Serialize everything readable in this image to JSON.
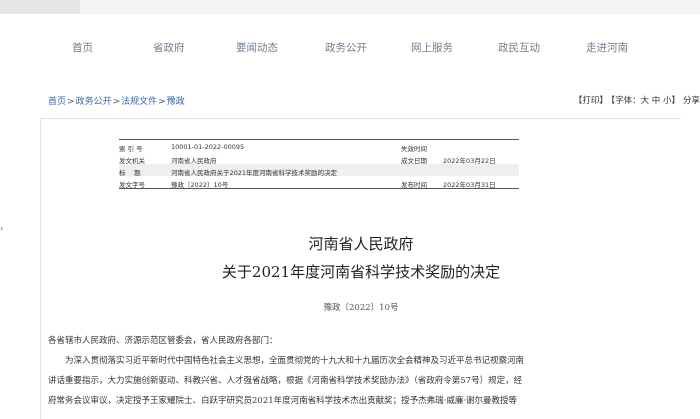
{
  "nav": {
    "items": [
      "首页",
      "省政府",
      "要闻动态",
      "政务公开",
      "网上服务",
      "政民互动",
      "走进河南"
    ]
  },
  "breadcrumb": {
    "items": [
      "首页",
      "政务公开",
      "法规文件",
      "豫政"
    ],
    "separator": ">"
  },
  "tools": {
    "print": "【打印】",
    "font": "【字体：大 中 小】",
    "share": "分享"
  },
  "meta": {
    "index_label": "索 引 号",
    "index_value": "10001-01-2022-00095",
    "expiry_label": "失效时间",
    "expiry_value": "",
    "issuer_label": "发文机关",
    "issuer_value": "河南省人民政府",
    "created_label": "成文日期",
    "created_value": "2022年03月22日",
    "title_label": "标　 题",
    "title_value": "河南省人民政府关于2021年度河南省科学技术奖励的决定",
    "docnum_label": "发文字号",
    "docnum_value": "豫政〔2022〕10号",
    "published_label": "发布时间",
    "published_value": "2022年03月31日"
  },
  "document": {
    "title_line1": "河南省人民政府",
    "title_line2": "关于2021年度河南省科学技术奖励的决定",
    "doc_number": "豫政〔2022〕10号",
    "salutation": "各省辖市人民政府、济源示范区管委会，省人民政府各部门：",
    "para1_line1": "为深入贯彻落实习近平新时代中国特色社会主义思想，全面贯彻党的十九大和十九届历次全会精神及习近平总书记视察河南",
    "para1_line2": "讲话重要指示，大力实施创新驱动、科教兴省、人才强省战略，根据《河南省科学技术奖励办法》（省政府令第57号）规定，经",
    "para1_line3": "府常务会议审议，决定授予王家耀院士、白跃宇研究员2021年度河南省科学技术杰出贡献奖；授予杰弗瑞·威廉·谢尔曼教授等"
  }
}
